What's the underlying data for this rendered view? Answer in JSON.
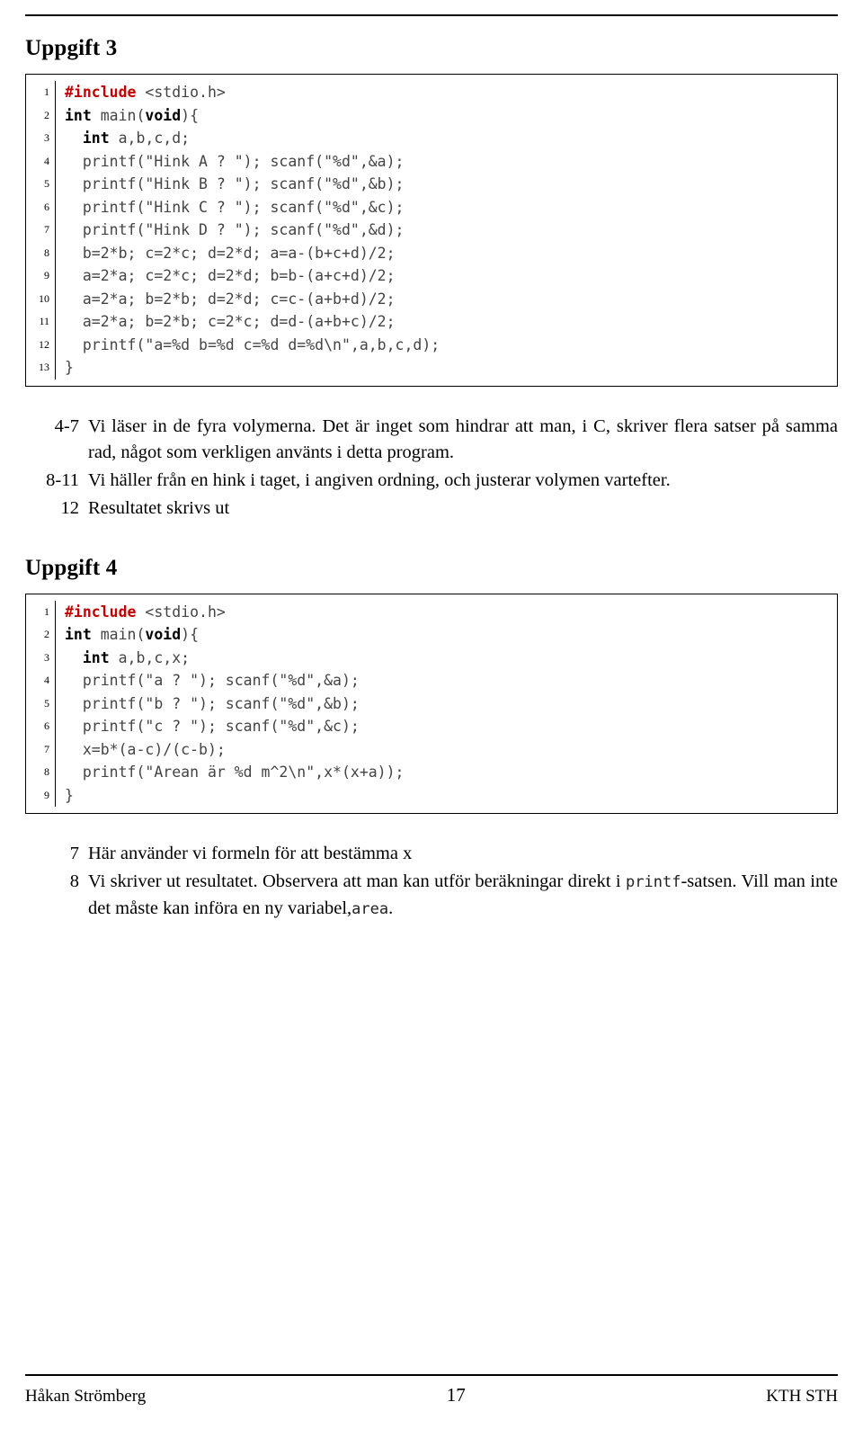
{
  "document": {
    "sections": [
      {
        "title": "Uppgift 3",
        "listing": {
          "lines": [
            {
              "n": "1",
              "tokens": [
                {
                  "t": "#include",
                  "c": "pp"
                },
                {
                  "t": " <stdio.h>",
                  "c": "plain"
                }
              ]
            },
            {
              "n": "2",
              "tokens": [
                {
                  "t": "int",
                  "c": "kw"
                },
                {
                  "t": " main(",
                  "c": "plain"
                },
                {
                  "t": "void",
                  "c": "kw"
                },
                {
                  "t": "){",
                  "c": "plain"
                }
              ]
            },
            {
              "n": "3",
              "tokens": [
                {
                  "t": "  ",
                  "c": "plain"
                },
                {
                  "t": "int",
                  "c": "kw"
                },
                {
                  "t": " a,b,c,d;",
                  "c": "plain"
                }
              ]
            },
            {
              "n": "4",
              "tokens": [
                {
                  "t": "  printf(\"Hink A ? \"); scanf(\"%d\",&a);",
                  "c": "plain"
                }
              ]
            },
            {
              "n": "5",
              "tokens": [
                {
                  "t": "  printf(\"Hink B ? \"); scanf(\"%d\",&b);",
                  "c": "plain"
                }
              ]
            },
            {
              "n": "6",
              "tokens": [
                {
                  "t": "  printf(\"Hink C ? \"); scanf(\"%d\",&c);",
                  "c": "plain"
                }
              ]
            },
            {
              "n": "7",
              "tokens": [
                {
                  "t": "  printf(\"Hink D ? \"); scanf(\"%d\",&d);",
                  "c": "plain"
                }
              ]
            },
            {
              "n": "8",
              "tokens": [
                {
                  "t": "  b=2*b; c=2*c; d=2*d; a=a-(b+c+d)/2;",
                  "c": "plain"
                }
              ]
            },
            {
              "n": "9",
              "tokens": [
                {
                  "t": "  a=2*a; c=2*c; d=2*d; b=b-(a+c+d)/2;",
                  "c": "plain"
                }
              ]
            },
            {
              "n": "10",
              "tokens": [
                {
                  "t": "  a=2*a; b=2*b; d=2*d; c=c-(a+b+d)/2;",
                  "c": "plain"
                }
              ]
            },
            {
              "n": "11",
              "tokens": [
                {
                  "t": "  a=2*a; b=2*b; c=2*c; d=d-(a+b+c)/2;",
                  "c": "plain"
                }
              ]
            },
            {
              "n": "12",
              "tokens": [
                {
                  "t": "  printf(\"a=%d b=%d c=%d d=%d\\n\",a,b,c,d);",
                  "c": "plain"
                }
              ]
            },
            {
              "n": "13",
              "tokens": [
                {
                  "t": "}",
                  "c": "plain"
                }
              ]
            }
          ]
        },
        "notes": [
          {
            "marker": "4-7",
            "text": "Vi läser in de fyra volymerna. Det är inget som hindrar att man, i C, skriver flera satser på samma rad, något som verkligen använts i detta program."
          },
          {
            "marker": "8-11",
            "text": "Vi häller från en hink i taget, i angiven ordning, och justerar volymen vartefter."
          },
          {
            "marker": "12",
            "text": "Resultatet skrivs ut"
          }
        ]
      },
      {
        "title": "Uppgift 4",
        "listing": {
          "lines": [
            {
              "n": "1",
              "tokens": [
                {
                  "t": "#include",
                  "c": "pp"
                },
                {
                  "t": " <stdio.h>",
                  "c": "plain"
                }
              ]
            },
            {
              "n": "2",
              "tokens": [
                {
                  "t": "int",
                  "c": "kw"
                },
                {
                  "t": " main(",
                  "c": "plain"
                },
                {
                  "t": "void",
                  "c": "kw"
                },
                {
                  "t": "){",
                  "c": "plain"
                }
              ]
            },
            {
              "n": "3",
              "tokens": [
                {
                  "t": "  ",
                  "c": "plain"
                },
                {
                  "t": "int",
                  "c": "kw"
                },
                {
                  "t": " a,b,c,x;",
                  "c": "plain"
                }
              ]
            },
            {
              "n": "4",
              "tokens": [
                {
                  "t": "  printf(\"a ? \"); scanf(\"%d\",&a);",
                  "c": "plain"
                }
              ]
            },
            {
              "n": "5",
              "tokens": [
                {
                  "t": "  printf(\"b ? \"); scanf(\"%d\",&b);",
                  "c": "plain"
                }
              ]
            },
            {
              "n": "6",
              "tokens": [
                {
                  "t": "  printf(\"c ? \"); scanf(\"%d\",&c);",
                  "c": "plain"
                }
              ]
            },
            {
              "n": "7",
              "tokens": [
                {
                  "t": "  x=b*(a-c)/(c-b);",
                  "c": "plain"
                }
              ]
            },
            {
              "n": "8",
              "tokens": [
                {
                  "t": "  printf(\"Arean är %d m^2\\n\",x*(x+a));",
                  "c": "plain"
                }
              ]
            },
            {
              "n": "9",
              "tokens": [
                {
                  "t": "}",
                  "c": "plain"
                }
              ]
            }
          ]
        },
        "notes": [
          {
            "marker": "7",
            "text": "Här använder vi formeln för att bestämma x"
          },
          {
            "marker": "8",
            "text_before": "Vi skriver ut resultatet. Observera att man kan utför beräkningar direkt i ",
            "mono": "printf",
            "text_after": "-satsen. Vill man inte det måste kan införa en ny variabel,",
            "mono2": "area",
            "text_end": "."
          }
        ]
      }
    ],
    "footer": {
      "left": "Håkan Strömberg",
      "center": "17",
      "right": "KTH STH"
    }
  }
}
